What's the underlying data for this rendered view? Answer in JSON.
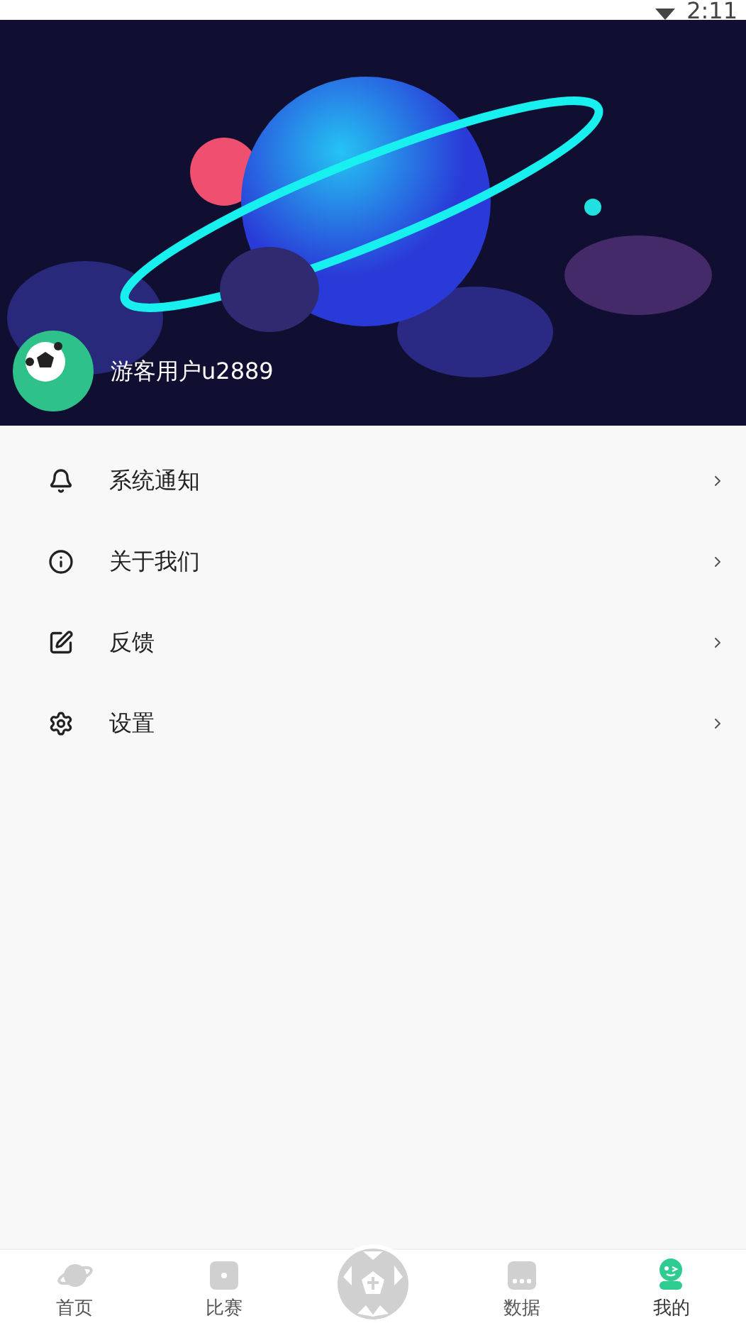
{
  "status_bar": {
    "time": "2:11"
  },
  "profile": {
    "username": "游客用户u2889"
  },
  "menu": [
    {
      "label": "系统通知"
    },
    {
      "label": "关于我们"
    },
    {
      "label": "反馈"
    },
    {
      "label": "设置"
    }
  ],
  "bottom_nav": [
    {
      "kind": "tab",
      "label": "首页",
      "selected": false
    },
    {
      "kind": "tab",
      "label": "比赛",
      "selected": false
    },
    {
      "kind": "center",
      "selected": false
    },
    {
      "kind": "tab",
      "label": "数据",
      "selected": false
    },
    {
      "kind": "tab",
      "label": "我的",
      "selected": true
    }
  ]
}
